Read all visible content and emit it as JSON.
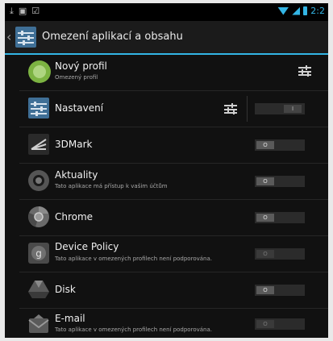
{
  "action_bar": {
    "title": "Omezení aplikací a obsahu"
  },
  "status_bar": {
    "time": "2:2"
  },
  "profile": {
    "name": "Nový profil",
    "subtitle": "Omezený profil"
  },
  "apps": [
    {
      "name": "Nastavení",
      "subtitle": "",
      "toggle": "I",
      "state": "on"
    },
    {
      "name": "3DMark",
      "subtitle": "",
      "toggle": "O",
      "state": "off"
    },
    {
      "name": "Aktuality",
      "subtitle": "Tato aplikace má přístup k vašim účtům",
      "toggle": "O",
      "state": "off"
    },
    {
      "name": "Chrome",
      "subtitle": "",
      "toggle": "O",
      "state": "off"
    },
    {
      "name": "Device Policy",
      "subtitle": "Tato aplikace v omezených profilech není podporována.",
      "toggle": "O",
      "state": "disabled"
    },
    {
      "name": "Disk",
      "subtitle": "",
      "toggle": "O",
      "state": "off"
    },
    {
      "name": "E-mail",
      "subtitle": "Tato aplikace v omezených profilech není podporována.",
      "toggle": "O",
      "state": "disabled"
    }
  ],
  "colors": {
    "accent": "#33b5e5",
    "background": "#111111"
  }
}
